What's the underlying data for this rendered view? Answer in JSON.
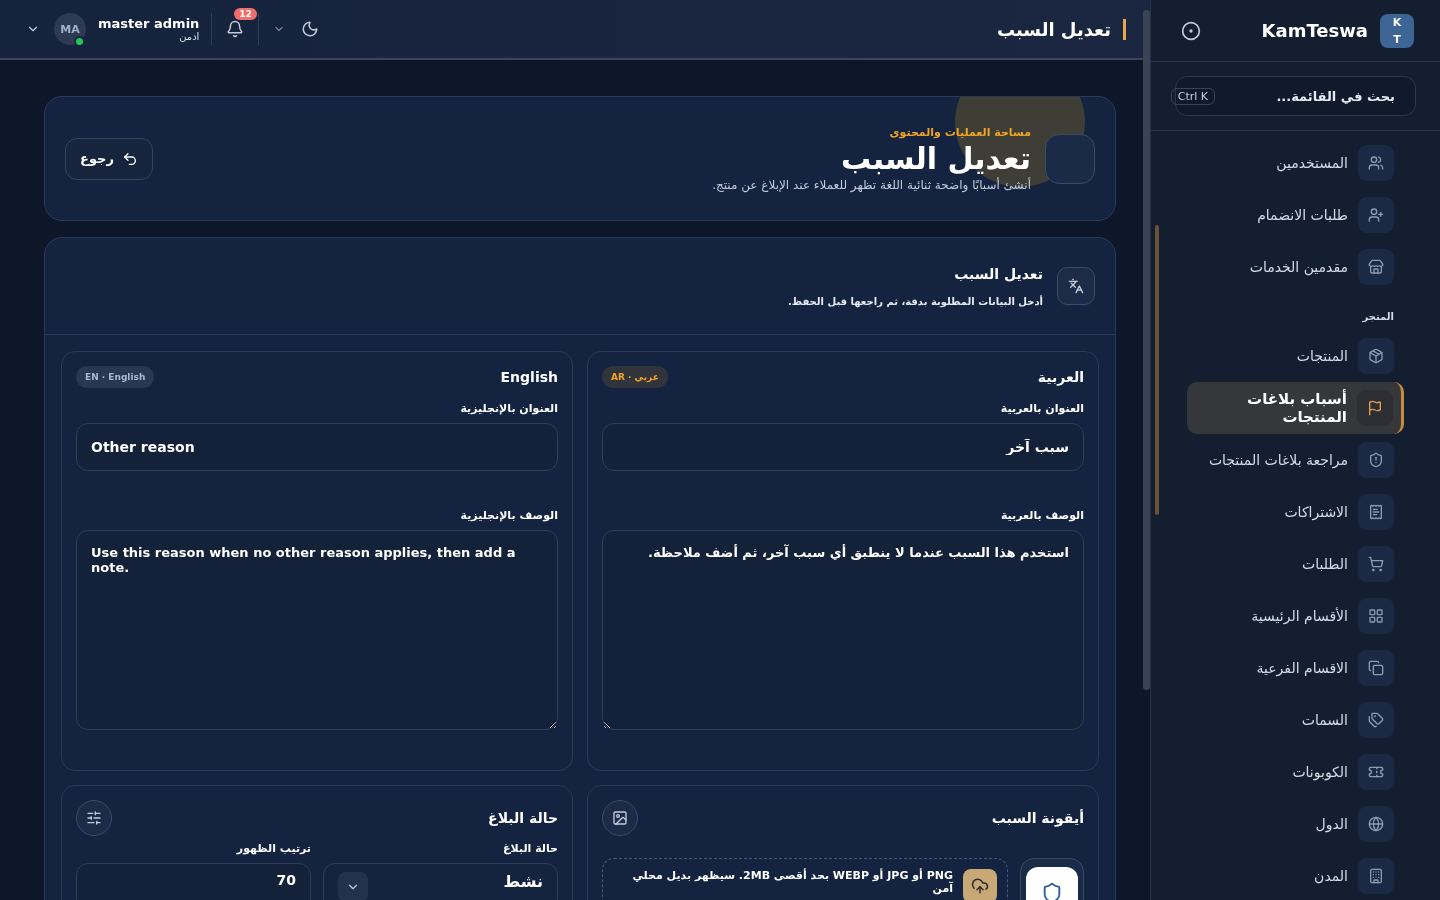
{
  "sidebar": {
    "brand": "KamTeswa",
    "logo": "K T",
    "search": {
      "placeholder": "بحث في القائمة...",
      "shortcut": "Ctrl K"
    },
    "items": [
      {
        "kind": "link",
        "label": "المستخدمين",
        "selected": false
      },
      {
        "kind": "link",
        "label": "طلبات الانضمام",
        "selected": false
      },
      {
        "kind": "link",
        "label": "مقدمين الخدمات",
        "selected": false
      },
      {
        "kind": "section",
        "label": "المتجر"
      },
      {
        "kind": "link",
        "label": "المنتجات",
        "selected": false
      },
      {
        "kind": "link",
        "label": "أسباب بلاغات المنتجات",
        "selected": true
      },
      {
        "kind": "link",
        "label": "مراجعة بلاغات المنتجات",
        "selected": false
      },
      {
        "kind": "link",
        "label": "الاشتراكات",
        "selected": false
      },
      {
        "kind": "link",
        "label": "الطلبات",
        "selected": false
      },
      {
        "kind": "link",
        "label": "الأقسام الرئيسية",
        "selected": false
      },
      {
        "kind": "link",
        "label": "الاقسام الفرعية",
        "selected": false
      },
      {
        "kind": "link",
        "label": "السمات",
        "selected": false
      },
      {
        "kind": "link",
        "label": "الكوبونات",
        "selected": false
      },
      {
        "kind": "link",
        "label": "الدول",
        "selected": false
      },
      {
        "kind": "link",
        "label": "المدن",
        "selected": false
      }
    ]
  },
  "topbar": {
    "title": "تعديل السبب",
    "user": {
      "initials": "MA",
      "name": "master admin",
      "role": "ادمن",
      "online": true
    },
    "notifications": "12"
  },
  "hero": {
    "eyebrow": "مساحة العمليات والمحتوى",
    "title": "تعديل السبب",
    "subtitle": "أنشئ أسبابًا واضحة ثنائية اللغة تظهر للعملاء عند الإبلاغ عن منتج.",
    "back": "رجوع"
  },
  "form": {
    "title": "تعديل السبب",
    "subtitle": "أدخل البيانات المطلوبة بدقة، ثم راجعها قبل الحفظ.",
    "languages": [
      {
        "heading": "العربية",
        "badge": "AR · عربي",
        "kind": "rtl",
        "title_label": "العنوان بالعربية",
        "title_value": "سبب آخر",
        "desc_label": "الوصف بالعربية",
        "desc_value": "استخدم هذا السبب عندما لا ينطبق أي سبب آخر، ثم أضف ملاحظة."
      },
      {
        "heading": "English",
        "badge": "EN · English",
        "kind": "ltr",
        "title_label": "العنوان بالإنجليزية",
        "title_value": "Other reason",
        "desc_label": "الوصف بالإنجليزية",
        "desc_value": "Use this reason when no other reason applies, then add a note."
      }
    ],
    "icon_card": {
      "title": "أيقونة السبب",
      "hint": "PNG أو JPG أو WEBP بحد أقصى 2MB. سيظهر بديل محلي آمن"
    },
    "status_card": {
      "title": "حالة البلاغ",
      "status_label": "حالة البلاغ",
      "status_value": "نشط",
      "order_label": "ترتيب الظهور",
      "order_value": "70"
    }
  }
}
